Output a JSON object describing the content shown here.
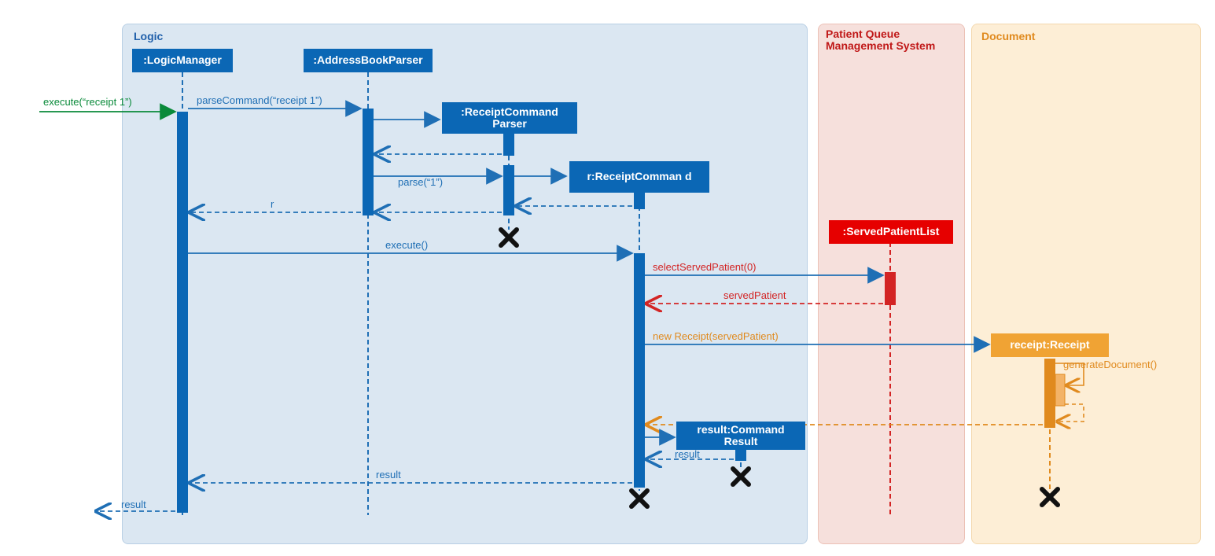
{
  "frames": {
    "logic": {
      "title": "Logic",
      "color": "#1f5faa"
    },
    "pqms": {
      "title": "Patient Queue Management System",
      "color": "#c01818"
    },
    "doc": {
      "title": "Document",
      "color": "#e08a1e"
    }
  },
  "lifelines": {
    "logic_manager": {
      "label": ":LogicManager"
    },
    "parser": {
      "label": ":AddressBookParser"
    },
    "rcmd_parser": {
      "label": ":ReceiptCommand Parser"
    },
    "rcmd": {
      "label": "r:ReceiptComman d"
    },
    "served_list": {
      "label": ":ServedPatientList"
    },
    "receipt": {
      "label": "receipt:Receipt"
    },
    "result": {
      "label": "result:Command Result"
    }
  },
  "messages": {
    "m1": "execute(“receipt 1”)",
    "m2": "parseCommand(“receipt  1”)",
    "m3": "parse(“1”)",
    "m4": "r",
    "m5": "execute()",
    "m6": "selectServedPatient(0)",
    "m7": "servedPatient",
    "m8": "new Receipt(servedPatient)",
    "m9": "generateDocument()",
    "m10": "result",
    "m11": "result",
    "m12": "result"
  }
}
